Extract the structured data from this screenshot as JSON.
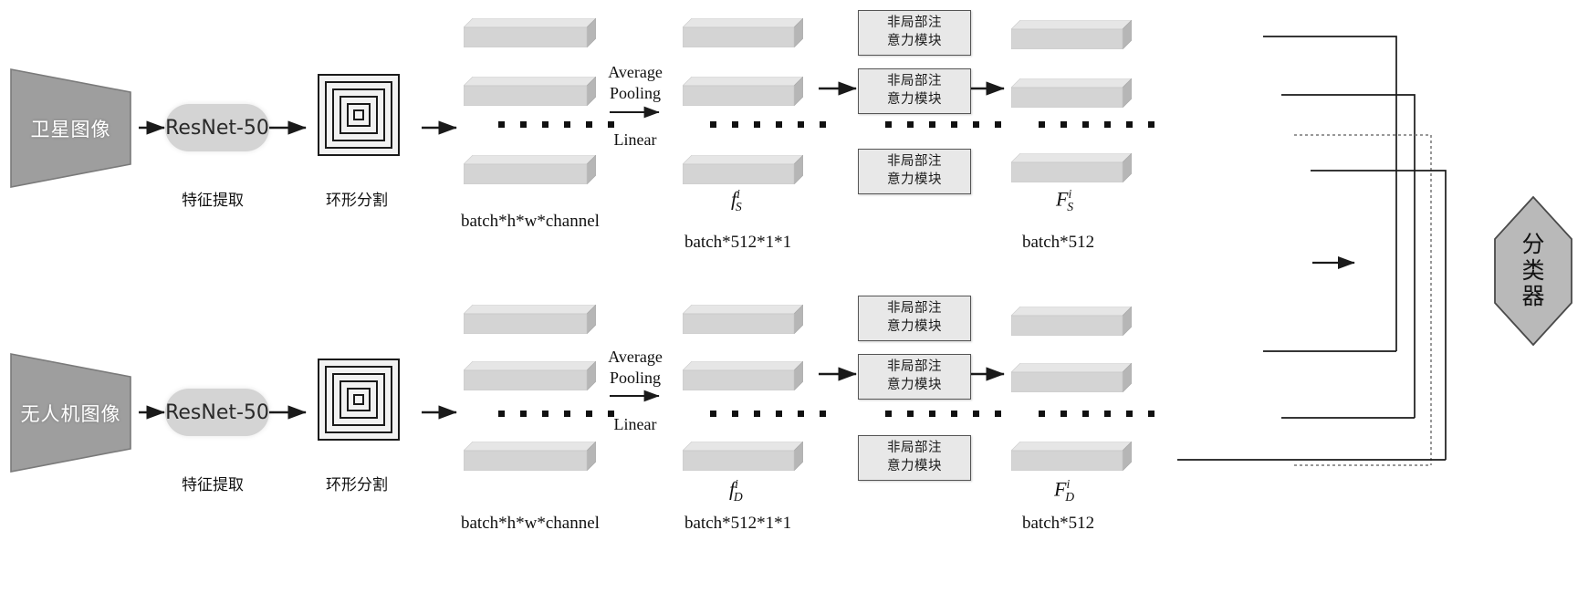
{
  "figure": {
    "title": "Dual-branch cross-view geo-localization network architecture",
    "colors": {
      "trapezoid_fill": "#9e9e9e",
      "trapezoid_stroke": "#6e6e6e",
      "pill_fill": "#d4d4d4",
      "slab_front": "#d2d2d2",
      "slab_top": "#e3e3e3",
      "slab_side": "#b8b8b8",
      "attention_fill": "#e8e8e8",
      "attention_stroke": "#555555",
      "hexagon_fill": "#b9b9b9",
      "hexagon_stroke": "#4a4a4a",
      "line": "#1a1a1a",
      "ring_fill": "#f2f2f2"
    }
  },
  "branches": {
    "satellite": {
      "input_label": "卫星图像",
      "backbone_label": "ResNet-50",
      "backbone_caption": "特征提取",
      "partition_caption": "环形分割",
      "feature_map_caption": "batch*h*w*channel",
      "pooled_symbol": {
        "base": "f",
        "sup": "i",
        "sub": "S"
      },
      "pooled_caption": "batch*512*1*1",
      "attention_label_line1": "非局部注",
      "attention_label_line2": "意力模块",
      "output_symbol": {
        "base": "F",
        "sup": "i",
        "sub": "S"
      },
      "output_caption": "batch*512",
      "op_pooling": "Average\nPooling",
      "op_linear": "Linear"
    },
    "drone": {
      "input_label": "无人机图像",
      "backbone_label": "ResNet-50",
      "backbone_caption": "特征提取",
      "partition_caption": "环形分割",
      "feature_map_caption": "batch*h*w*channel",
      "pooled_symbol": {
        "base": "f",
        "sup": "i",
        "sub": "D"
      },
      "pooled_caption": "batch*512*1*1",
      "attention_label_line1": "非局部注",
      "attention_label_line2": "意力模块",
      "output_symbol": {
        "base": "F",
        "sup": "i",
        "sub": "D"
      },
      "output_caption": "batch*512",
      "op_pooling": "Average\nPooling",
      "op_linear": "Linear"
    }
  },
  "operations": {
    "average_pooling_line1": "Average",
    "average_pooling_line2": "Pooling",
    "linear": "Linear"
  },
  "classifier": {
    "label_line1": "分",
    "label_line2": "类",
    "label_line3": "器"
  },
  "ellipsis": {
    "dot_count": 6
  }
}
